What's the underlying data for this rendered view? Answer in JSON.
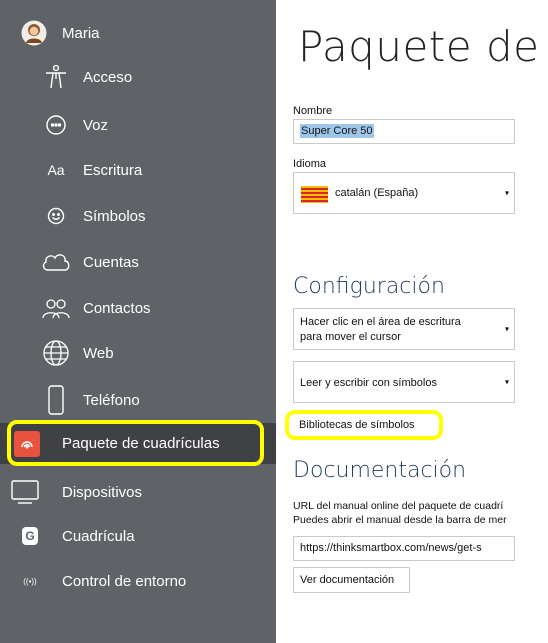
{
  "sidebar": {
    "user": {
      "name": "Maria",
      "icon": "user-avatar"
    },
    "items": [
      {
        "key": "acceso",
        "label": "Acceso",
        "icon": "accessibility-person-icon"
      },
      {
        "key": "voz",
        "label": "Voz",
        "icon": "speech-bubble-icon"
      },
      {
        "key": "escritura",
        "label": "Escritura",
        "icon": "text-aa-icon",
        "icon_text": "Aa"
      },
      {
        "key": "simbolos",
        "label": "Símbolos",
        "icon": "smiley-icon"
      },
      {
        "key": "cuentas",
        "label": "Cuentas",
        "icon": "cloud-icon"
      },
      {
        "key": "contactos",
        "label": "Contactos",
        "icon": "people-icon"
      },
      {
        "key": "web",
        "label": "Web",
        "icon": "globe-icon"
      },
      {
        "key": "telefono",
        "label": "Teléfono",
        "icon": "phone-icon"
      },
      {
        "key": "paquete",
        "label": "Paquete de cuadrículas",
        "icon": "grid-pack-icon"
      },
      {
        "key": "dispositivos",
        "label": "Dispositivos",
        "icon": "monitor-icon"
      },
      {
        "key": "cuadricula",
        "label": "Cuadrícula",
        "icon": "grid3-logo-icon",
        "icon_text": "G"
      },
      {
        "key": "entorno",
        "label": "Control de entorno",
        "icon": "signal-waves-icon",
        "icon_text": "((•))"
      }
    ],
    "active": "paquete",
    "colors": {
      "background": "#5f6368",
      "active_background": "#3f4144",
      "active_icon": "#e8533f",
      "highlight": "#ffff00"
    }
  },
  "main": {
    "title": "Paquete de",
    "nombre": {
      "label": "Nombre",
      "value": "Super Core 50"
    },
    "idioma": {
      "label": "Idioma",
      "value": "catalán (España)",
      "flag": "catalonia-flag"
    },
    "configuracion": {
      "heading": "Configuración",
      "option1_line1": "Hacer clic en el área de escritura",
      "option1_line2": "para mover el cursor",
      "option2": "Leer y escribir con símbolos",
      "libraries_button": "Bibliotecas de símbolos"
    },
    "documentacion": {
      "heading": "Documentación",
      "desc_line1": "URL del manual online del paquete de cuadrí",
      "desc_line2": "Puedes abrir el manual desde la barra de mer",
      "url_value": "https://thinksmartbox.com/news/get-s",
      "view_button": "Ver documentación"
    }
  }
}
